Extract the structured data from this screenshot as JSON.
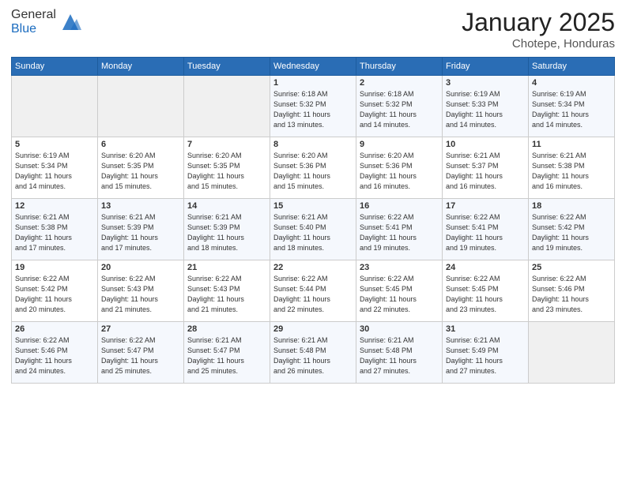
{
  "logo": {
    "general": "General",
    "blue": "Blue"
  },
  "title": "January 2025",
  "subtitle": "Chotepe, Honduras",
  "headers": [
    "Sunday",
    "Monday",
    "Tuesday",
    "Wednesday",
    "Thursday",
    "Friday",
    "Saturday"
  ],
  "weeks": [
    [
      {
        "day": "",
        "text": ""
      },
      {
        "day": "",
        "text": ""
      },
      {
        "day": "",
        "text": ""
      },
      {
        "day": "1",
        "text": "Sunrise: 6:18 AM\nSunset: 5:32 PM\nDaylight: 11 hours\nand 13 minutes."
      },
      {
        "day": "2",
        "text": "Sunrise: 6:18 AM\nSunset: 5:32 PM\nDaylight: 11 hours\nand 14 minutes."
      },
      {
        "day": "3",
        "text": "Sunrise: 6:19 AM\nSunset: 5:33 PM\nDaylight: 11 hours\nand 14 minutes."
      },
      {
        "day": "4",
        "text": "Sunrise: 6:19 AM\nSunset: 5:34 PM\nDaylight: 11 hours\nand 14 minutes."
      }
    ],
    [
      {
        "day": "5",
        "text": "Sunrise: 6:19 AM\nSunset: 5:34 PM\nDaylight: 11 hours\nand 14 minutes."
      },
      {
        "day": "6",
        "text": "Sunrise: 6:20 AM\nSunset: 5:35 PM\nDaylight: 11 hours\nand 15 minutes."
      },
      {
        "day": "7",
        "text": "Sunrise: 6:20 AM\nSunset: 5:35 PM\nDaylight: 11 hours\nand 15 minutes."
      },
      {
        "day": "8",
        "text": "Sunrise: 6:20 AM\nSunset: 5:36 PM\nDaylight: 11 hours\nand 15 minutes."
      },
      {
        "day": "9",
        "text": "Sunrise: 6:20 AM\nSunset: 5:36 PM\nDaylight: 11 hours\nand 16 minutes."
      },
      {
        "day": "10",
        "text": "Sunrise: 6:21 AM\nSunset: 5:37 PM\nDaylight: 11 hours\nand 16 minutes."
      },
      {
        "day": "11",
        "text": "Sunrise: 6:21 AM\nSunset: 5:38 PM\nDaylight: 11 hours\nand 16 minutes."
      }
    ],
    [
      {
        "day": "12",
        "text": "Sunrise: 6:21 AM\nSunset: 5:38 PM\nDaylight: 11 hours\nand 17 minutes."
      },
      {
        "day": "13",
        "text": "Sunrise: 6:21 AM\nSunset: 5:39 PM\nDaylight: 11 hours\nand 17 minutes."
      },
      {
        "day": "14",
        "text": "Sunrise: 6:21 AM\nSunset: 5:39 PM\nDaylight: 11 hours\nand 18 minutes."
      },
      {
        "day": "15",
        "text": "Sunrise: 6:21 AM\nSunset: 5:40 PM\nDaylight: 11 hours\nand 18 minutes."
      },
      {
        "day": "16",
        "text": "Sunrise: 6:22 AM\nSunset: 5:41 PM\nDaylight: 11 hours\nand 19 minutes."
      },
      {
        "day": "17",
        "text": "Sunrise: 6:22 AM\nSunset: 5:41 PM\nDaylight: 11 hours\nand 19 minutes."
      },
      {
        "day": "18",
        "text": "Sunrise: 6:22 AM\nSunset: 5:42 PM\nDaylight: 11 hours\nand 19 minutes."
      }
    ],
    [
      {
        "day": "19",
        "text": "Sunrise: 6:22 AM\nSunset: 5:42 PM\nDaylight: 11 hours\nand 20 minutes."
      },
      {
        "day": "20",
        "text": "Sunrise: 6:22 AM\nSunset: 5:43 PM\nDaylight: 11 hours\nand 21 minutes."
      },
      {
        "day": "21",
        "text": "Sunrise: 6:22 AM\nSunset: 5:43 PM\nDaylight: 11 hours\nand 21 minutes."
      },
      {
        "day": "22",
        "text": "Sunrise: 6:22 AM\nSunset: 5:44 PM\nDaylight: 11 hours\nand 22 minutes."
      },
      {
        "day": "23",
        "text": "Sunrise: 6:22 AM\nSunset: 5:45 PM\nDaylight: 11 hours\nand 22 minutes."
      },
      {
        "day": "24",
        "text": "Sunrise: 6:22 AM\nSunset: 5:45 PM\nDaylight: 11 hours\nand 23 minutes."
      },
      {
        "day": "25",
        "text": "Sunrise: 6:22 AM\nSunset: 5:46 PM\nDaylight: 11 hours\nand 23 minutes."
      }
    ],
    [
      {
        "day": "26",
        "text": "Sunrise: 6:22 AM\nSunset: 5:46 PM\nDaylight: 11 hours\nand 24 minutes."
      },
      {
        "day": "27",
        "text": "Sunrise: 6:22 AM\nSunset: 5:47 PM\nDaylight: 11 hours\nand 25 minutes."
      },
      {
        "day": "28",
        "text": "Sunrise: 6:21 AM\nSunset: 5:47 PM\nDaylight: 11 hours\nand 25 minutes."
      },
      {
        "day": "29",
        "text": "Sunrise: 6:21 AM\nSunset: 5:48 PM\nDaylight: 11 hours\nand 26 minutes."
      },
      {
        "day": "30",
        "text": "Sunrise: 6:21 AM\nSunset: 5:48 PM\nDaylight: 11 hours\nand 27 minutes."
      },
      {
        "day": "31",
        "text": "Sunrise: 6:21 AM\nSunset: 5:49 PM\nDaylight: 11 hours\nand 27 minutes."
      },
      {
        "day": "",
        "text": ""
      }
    ]
  ]
}
